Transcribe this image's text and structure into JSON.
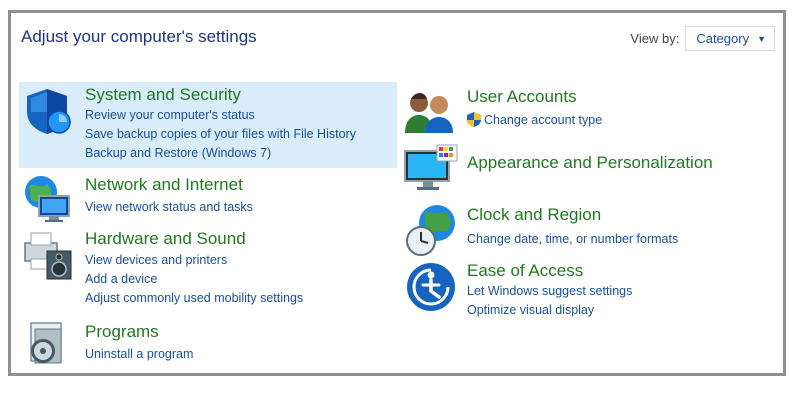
{
  "header": {
    "title": "Adjust your computer's settings",
    "view_by_label": "View by:",
    "view_by_value": "Category"
  },
  "categories": [
    {
      "title": "System and Security",
      "icon": "shield-icon",
      "links": [
        "Review your computer's status",
        "Save backup copies of your files with File History",
        "Backup and Restore (Windows 7)"
      ]
    },
    {
      "title": "Network and Internet",
      "icon": "network-globe-icon",
      "links": [
        "View network status and tasks"
      ]
    },
    {
      "title": "Hardware and Sound",
      "icon": "printer-speaker-icon",
      "links": [
        "View devices and printers",
        "Add a device",
        "Adjust commonly used mobility settings"
      ]
    },
    {
      "title": "Programs",
      "icon": "programs-disc-icon",
      "links": [
        "Uninstall a program"
      ]
    },
    {
      "title": "User Accounts",
      "icon": "users-icon",
      "links": [
        "Change account type"
      ]
    },
    {
      "title": "Appearance and Personalization",
      "icon": "monitor-palette-icon",
      "links": []
    },
    {
      "title": "Clock and Region",
      "icon": "clock-globe-icon",
      "links": [
        "Change date, time, or number formats"
      ]
    },
    {
      "title": "Ease of Access",
      "icon": "ease-of-access-icon",
      "links": [
        "Let Windows suggest settings",
        "Optimize visual display"
      ]
    }
  ],
  "colors": {
    "title_blue": "#1e3287",
    "category_green": "#1f7a1f",
    "link_blue": "#1a4fa0",
    "hover_highlight": "#d9ecfa"
  }
}
